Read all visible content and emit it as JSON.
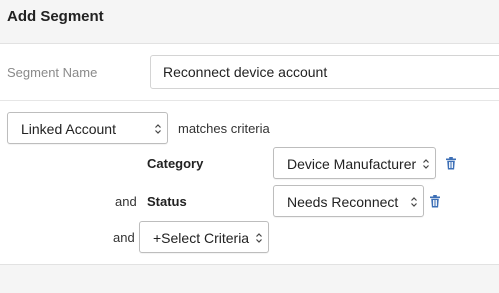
{
  "dialog": {
    "title": "Add Segment"
  },
  "segment_name": {
    "label": "Segment Name",
    "value": "Reconnect device account"
  },
  "criteria": {
    "entity_select": "Linked Account",
    "matches_text": "matches criteria",
    "rows": [
      {
        "connector": "",
        "field": "Category",
        "value": "Device Manufacturer"
      },
      {
        "connector": "and",
        "field": "Status",
        "value": "Needs Reconnect"
      }
    ],
    "add_row": {
      "connector": "and",
      "select_label": "+Select Criteria"
    }
  },
  "colors": {
    "accent": "#3d6fb6",
    "muted_label": "#8a8a8a"
  },
  "icons": {
    "chevron": "chevron-up-down-icon",
    "delete": "trash-icon"
  }
}
